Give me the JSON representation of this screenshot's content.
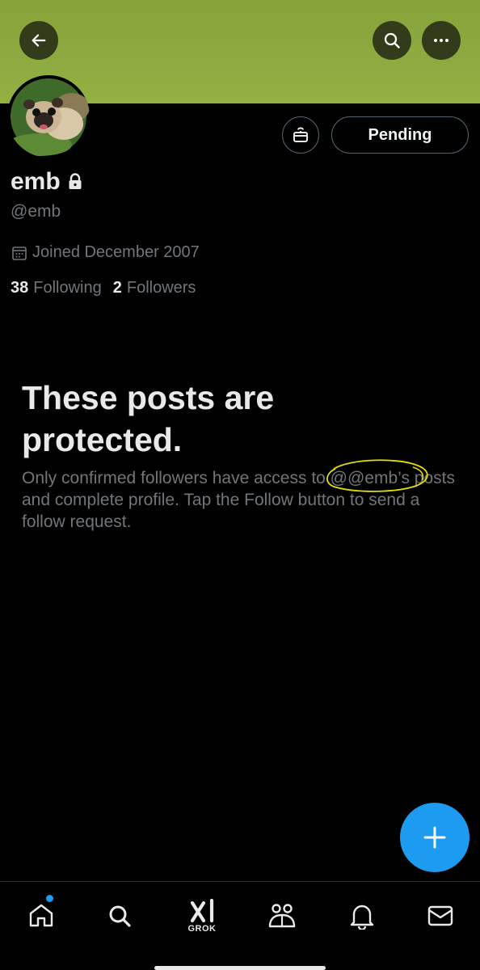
{
  "header": {
    "back_icon": "arrow-left-icon",
    "search_icon": "search-icon",
    "more_icon": "more-horizontal-icon",
    "banner_color": "#8dab40"
  },
  "profile": {
    "display_name": "emb",
    "handle": "@emb",
    "locked_icon": "lock-icon",
    "joined": "Joined December 2007",
    "following_count": "38",
    "following_label": "Following",
    "followers_count": "2",
    "followers_label": "Followers",
    "pending_label": "Pending",
    "gift_icon": "gift-icon"
  },
  "protected_notice": {
    "title": "These posts are protected.",
    "body_before": "Only confirmed followers have access to ",
    "body_handle": "@@emb’s",
    "body_after": " posts and complete profile. Tap the Follow button to send a follow request.",
    "annotation_color": "#e3e000"
  },
  "fab": {
    "icon": "plus-icon",
    "color": "#1d9bf0"
  },
  "bottom_nav": {
    "items": [
      "home-icon",
      "search-icon",
      "grok-icon",
      "communities-icon",
      "notifications-icon",
      "messages-icon"
    ],
    "grok_label": "GROK"
  },
  "colors": {
    "accent": "#1d9bf0",
    "background": "#000000",
    "secondary_text": "#71767b"
  }
}
